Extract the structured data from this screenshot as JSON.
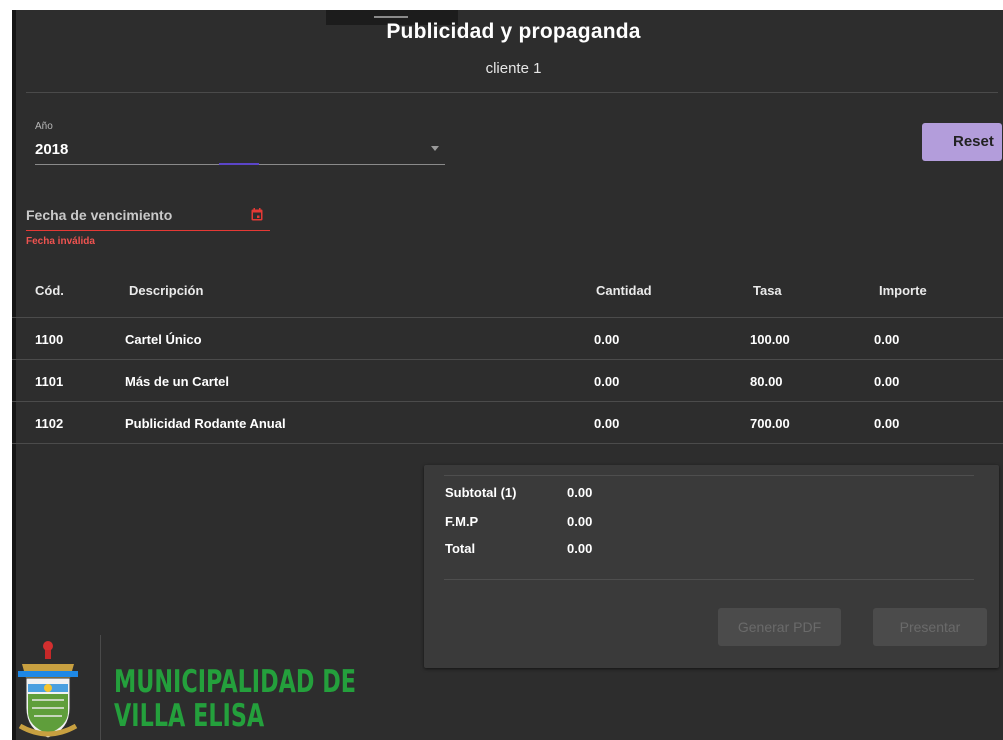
{
  "header": {
    "title": "Publicidad y propaganda",
    "subtitle": "cliente 1"
  },
  "filters": {
    "year_label": "Año",
    "year_value": "2018",
    "reset_label": "Reset",
    "date_label": "Fecha de vencimiento",
    "date_error": "Fecha inválida"
  },
  "table": {
    "columns": [
      "Cód.",
      "Descripción",
      "Cantidad",
      "Tasa",
      "Importe"
    ],
    "rows": [
      [
        "1100",
        "Cartel Único",
        "0.00",
        "100.00",
        "0.00"
      ],
      [
        "1101",
        "Más de un Cartel",
        "0.00",
        "80.00",
        "0.00"
      ],
      [
        "1102",
        "Publicidad Rodante Anual",
        "0.00",
        "700.00",
        "0.00"
      ]
    ]
  },
  "summary": {
    "subtotal_label": "Subtotal (1)",
    "subtotal_value": "0.00",
    "fmp_label": "F.M.P",
    "fmp_value": "0.00",
    "total_label": "Total",
    "total_value": "0.00",
    "pdf_label": "Generar PDF",
    "submit_label": "Presentar"
  },
  "logo": {
    "line1": "MUNICIPALIDAD DE",
    "line2": "VILLA ELISA"
  },
  "colors": {
    "background": "#2d2d2d",
    "accent": "#b39ddb",
    "error": "#e53935",
    "brand_green": "#24a03c"
  }
}
